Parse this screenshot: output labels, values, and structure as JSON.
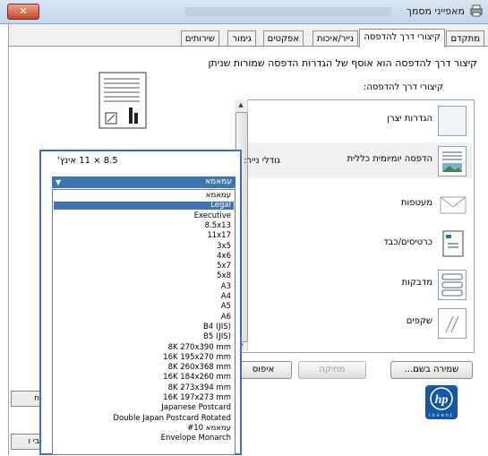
{
  "window": {
    "title": "מאפייני מסמך",
    "close_glyph": "✕"
  },
  "tabs": [
    {
      "label": "מתקדם",
      "active": false
    },
    {
      "label": "קיצורי דרך להדפסה",
      "active": true
    },
    {
      "label": "נייר/איכות",
      "active": false
    },
    {
      "label": "אפקטים",
      "active": false
    },
    {
      "label": "גימור",
      "active": false
    },
    {
      "label": "שירותים",
      "active": false
    }
  ],
  "panel": {
    "description": "קיצור דרך להדפסה הוא אוסף של הגדרות הדפסה שמורות שניתן",
    "list_label": "קיצורי דרך להדפסה:"
  },
  "shortcuts": [
    {
      "label": "הגדרות יצרן",
      "icon": "factory-defaults-icon"
    },
    {
      "label": "הדפסה יומיומית כללית",
      "icon": "everyday-printing-icon"
    },
    {
      "label": "מעטפות",
      "icon": "envelope-icon"
    },
    {
      "label": "כרטיסים/כבד",
      "icon": "cardstock-icon"
    },
    {
      "label": "מדבקות",
      "icon": "labels-icon"
    },
    {
      "label": "שקפים",
      "icon": "transparency-icon"
    }
  ],
  "buttons": {
    "save_as": "שמירה בשם...",
    "delete": "מחיקה",
    "reset": "איפוס"
  },
  "hp_logo": {
    "letters": "hp",
    "tagline": "invent"
  },
  "paper": {
    "label": "גודלי נייר:",
    "dims": "8.5 × 11 אינץ'",
    "selected": "עמאמא",
    "options": [
      "עמאמא",
      "Legal",
      "Executive",
      "8.5x13",
      "11x17",
      "3x5",
      "4x6",
      "5x7",
      "5x8",
      "A3",
      "A4",
      "A5",
      "A6",
      "B4 (JIS)",
      "B5 (JIS)",
      "8K 270x390 mm",
      "16K 195x270 mm",
      "8K 260x368 mm",
      "16K 184x260 mm",
      "8K 273x394 mm",
      "16K 197x273 mm",
      "Japanese Postcard",
      "Double Japan Postcard Rotated",
      "עמאמא #10",
      "Envelope Monarch"
    ],
    "selected_index": 1
  },
  "clipped_buttons": [
    "ח",
    "בי ו"
  ]
}
